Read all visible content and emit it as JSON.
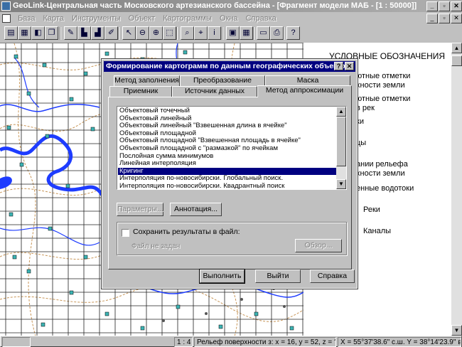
{
  "window": {
    "title": "GeoLink-Центральная часть Московского артезианского бассейна - [Фрагмент модели МАБ - [1 : 50000]]",
    "minimize": "_",
    "restore": "▫",
    "close": "✕"
  },
  "menu": {
    "items": [
      "База",
      "Карта",
      "Инструменты",
      "Объект",
      "Картограммы",
      "Окна",
      "Справка"
    ],
    "doc_minimize": "_",
    "doc_restore": "▫",
    "doc_close": "✕"
  },
  "toolbar": {
    "buttons": [
      {
        "icon": "open-database-icon",
        "glyph": "▤"
      },
      {
        "icon": "table-icon",
        "glyph": "▦"
      },
      {
        "icon": "layers-icon",
        "glyph": "◧"
      },
      {
        "icon": "copy-icon",
        "glyph": "❐"
      },
      {
        "icon": "chart-edit-icon",
        "glyph": "✎"
      },
      {
        "icon": "chart-icon",
        "glyph": "▙"
      },
      {
        "icon": "chart-green-icon",
        "glyph": "▟"
      },
      {
        "icon": "chart-pen-icon",
        "glyph": "✐"
      },
      {
        "icon": "pointer-icon",
        "glyph": "↖"
      },
      {
        "icon": "zoom-out-icon",
        "glyph": "⊖"
      },
      {
        "icon": "zoom-in-icon",
        "glyph": "⊕"
      },
      {
        "icon": "zoom-window-icon",
        "glyph": "⬚"
      },
      {
        "icon": "identify-icon",
        "glyph": "⌕"
      },
      {
        "icon": "query-icon",
        "glyph": "⌖"
      },
      {
        "icon": "info-icon",
        "glyph": "i"
      },
      {
        "icon": "layer-green-icon",
        "glyph": "▣"
      },
      {
        "icon": "grid-icon",
        "glyph": "▦"
      },
      {
        "icon": "print-preview-icon",
        "glyph": "▭"
      },
      {
        "icon": "print-icon",
        "glyph": "⎙"
      },
      {
        "icon": "help-icon",
        "glyph": "?"
      }
    ]
  },
  "legend": {
    "title": "УСЛОВНЫЕ ОБОЗНАЧЕНИЯ",
    "lines": [
      "ютные  отметки",
      "хности     земли",
      "ютные  отметки",
      "в   рек",
      "ки",
      "цы",
      "ании  рельефа",
      "хности  земли",
      "енные водотоки",
      "Реки",
      "Каналы"
    ]
  },
  "status": {
    "scale": "1 : 4",
    "layer": "Рельеф поверхности з: x = 16, y = 52, z = ?",
    "coords": "X = 55°37'38.6\" с.ш.  Y = 38°14'23.9\" в.д."
  },
  "dialog": {
    "title": "Формирование картограмм по данным географических объектов",
    "help_caption": "?",
    "close_caption": "✕",
    "tabs_back": [
      "Метод заполнения",
      "Преобразование",
      "Маска"
    ],
    "tabs_front": [
      "Приемник",
      "Источник данных",
      "Метод аппроксимации"
    ],
    "active_tab": "Метод аппроксимации",
    "methods": [
      "Объектовый точечный",
      "Объектовый линейный",
      "Объектовый линейный \"Взвешенная длина в ячейке\"",
      "Объектовый площадной",
      "Объектовый площадной \"Взвешенная площадь в ячейке\"",
      "Объектовый площадной с \"размазкой\" по ячейкам",
      "Послойная сумма минимумов",
      "Линейная  интерполяция",
      "Кригинг",
      "Интерполяция по-новосибирски. Глобальный поиск.",
      "Интерполяция по-новосибирски. Квадрантный поиск"
    ],
    "selected_method": "Кригинг",
    "params_button": "Параметры...",
    "annotation_button": "Аннотация...",
    "save_label": "Сохранить результаты в файл:",
    "save_checked": false,
    "file_placeholder": "Файл не задан",
    "browse_button": "Обзор...",
    "run_button": "Выполнить",
    "exit_button": "Выйти",
    "help_button": "Справка"
  },
  "colors": {
    "title_active": "#000080",
    "face": "#c0c0c0",
    "river": "#1e3cff",
    "contour": "#c89658",
    "grid": "#202020",
    "well": "#3cb4b4"
  }
}
